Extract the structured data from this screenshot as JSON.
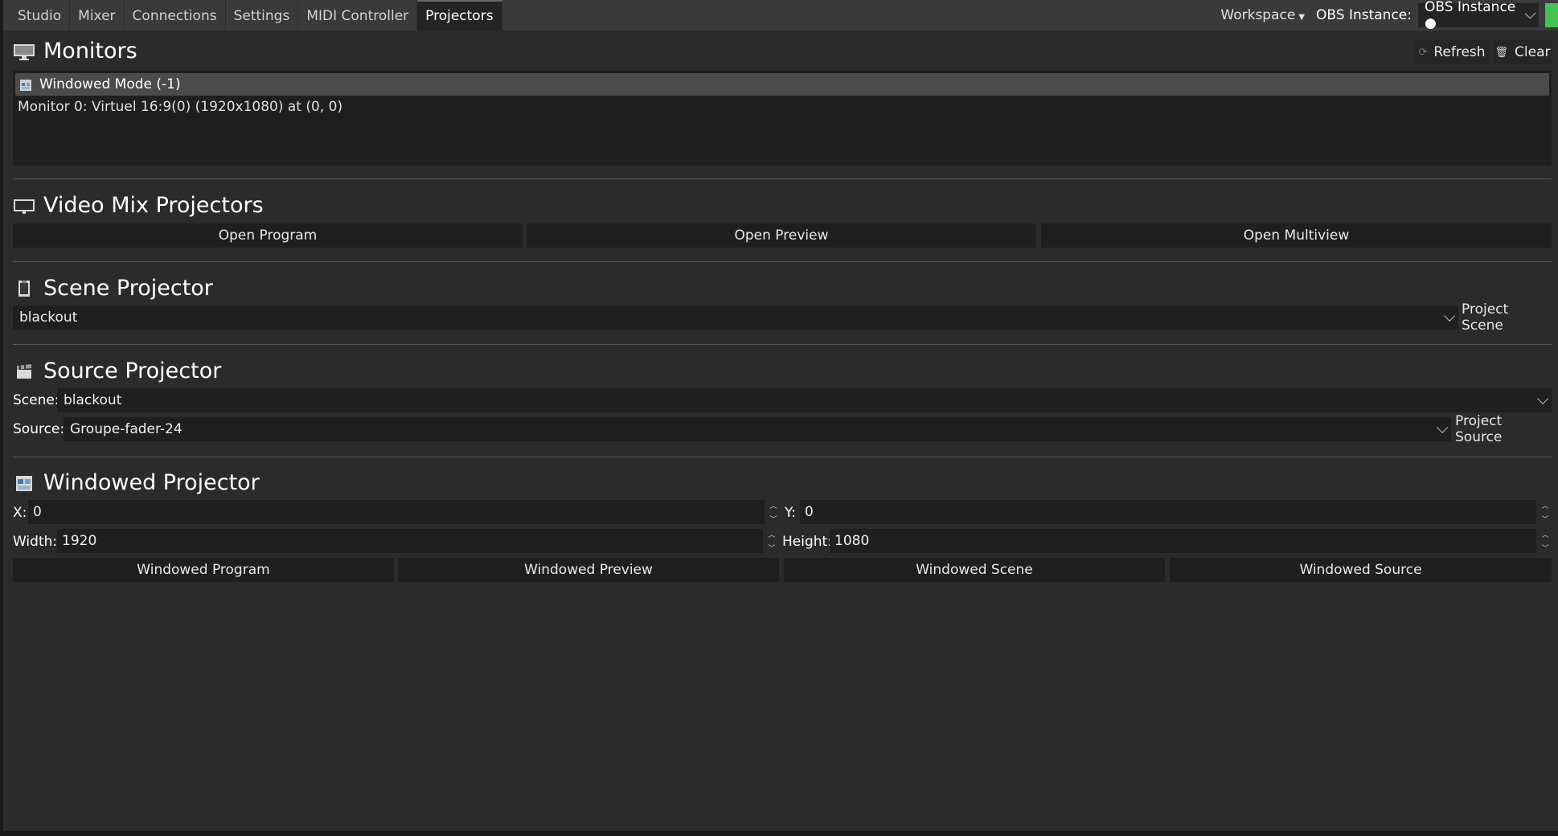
{
  "tabs": [
    {
      "label": "Studio"
    },
    {
      "label": "Mixer"
    },
    {
      "label": "Connections"
    },
    {
      "label": "Settings"
    },
    {
      "label": "MIDI Controller"
    },
    {
      "label": "Projectors",
      "active": true
    }
  ],
  "topbar": {
    "workspace_label": "Workspace",
    "obs_instance_label": "OBS Instance:",
    "obs_instance_value": "OBS Instance ●",
    "status_color": "#46c252"
  },
  "monitors": {
    "title": "Monitors",
    "refresh_label": "Refresh",
    "clear_label": "Clear",
    "items": [
      {
        "label": "Windowed Mode (-1)",
        "selected": true
      },
      {
        "label": "Monitor 0: Virtuel 16:9(0) (1920x1080) at (0, 0)"
      }
    ]
  },
  "video_mix": {
    "title": "Video Mix Projectors",
    "open_program": "Open Program",
    "open_preview": "Open Preview",
    "open_multiview": "Open Multiview"
  },
  "scene_projector": {
    "title": "Scene Projector",
    "selected_scene": "blackout",
    "project_label": "Project Scene"
  },
  "source_projector": {
    "title": "Source Projector",
    "scene_label": "Scene:",
    "scene_value": "blackout",
    "source_label": "Source:",
    "source_value": "Groupe-fader-24",
    "project_label": "Project Source"
  },
  "windowed_projector": {
    "title": "Windowed Projector",
    "x_label": "X:",
    "x_value": "0",
    "y_label": "Y:",
    "y_value": "0",
    "width_label": "Width:",
    "width_value": "1920",
    "height_label": "Height:",
    "height_value": "1080",
    "windowed_program": "Windowed Program",
    "windowed_preview": "Windowed Preview",
    "windowed_scene": "Windowed Scene",
    "windowed_source": "Windowed Source"
  }
}
